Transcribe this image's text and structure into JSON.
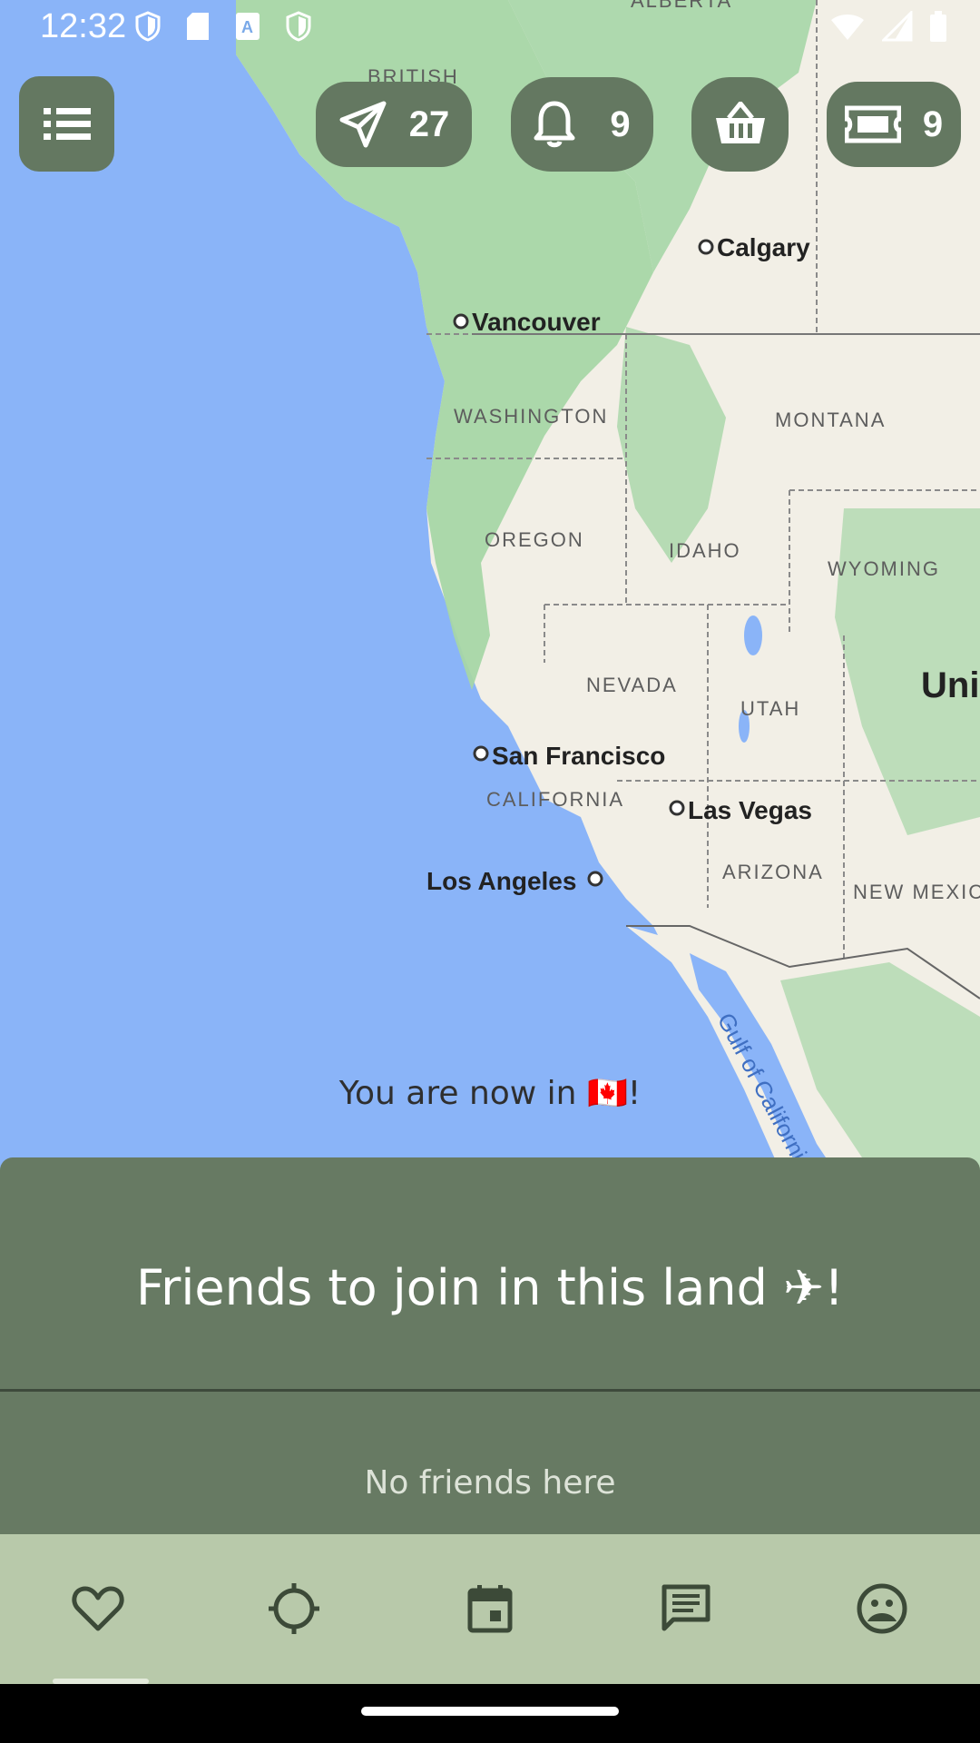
{
  "status_bar": {
    "time": "12:32"
  },
  "top_bar": {
    "menu_icon": "list-icon",
    "sent": {
      "icon": "paper-plane-icon",
      "count": "27"
    },
    "notifications": {
      "icon": "bell-icon",
      "count": "9"
    },
    "basket": {
      "icon": "basket-icon"
    },
    "tickets": {
      "icon": "ticket-icon",
      "count": "9"
    }
  },
  "map": {
    "regions": [
      "ALBERTA",
      "BRITISH",
      "WASHINGTON",
      "MONTANA",
      "OREGON",
      "IDAHO",
      "WYOMING",
      "NEVADA",
      "UTAH",
      "CALIFORNIA",
      "ARIZONA",
      "NEW MEXIC",
      "Uni"
    ],
    "cities": [
      "Calgary",
      "Vancouver",
      "San Francisco",
      "Las Vegas",
      "Los Angeles"
    ],
    "water": "Gulf of Californi"
  },
  "location_message": "You are now in 🇨🇦!",
  "friends_sheet": {
    "title": "Friends to join in this land ✈!",
    "empty_text": "No friends here"
  },
  "bottom_nav": {
    "items": [
      {
        "icon": "heart-icon"
      },
      {
        "icon": "crosshair-icon"
      },
      {
        "icon": "calendar-icon"
      },
      {
        "icon": "chat-icon"
      },
      {
        "icon": "face-icon"
      }
    ]
  },
  "colors": {
    "ocean": "#8ab4f8",
    "land": "#f2efe6",
    "forest": "#a6d6a7",
    "button": "#647861",
    "sheet": "#677a63",
    "nav": "#b8c9aa"
  }
}
